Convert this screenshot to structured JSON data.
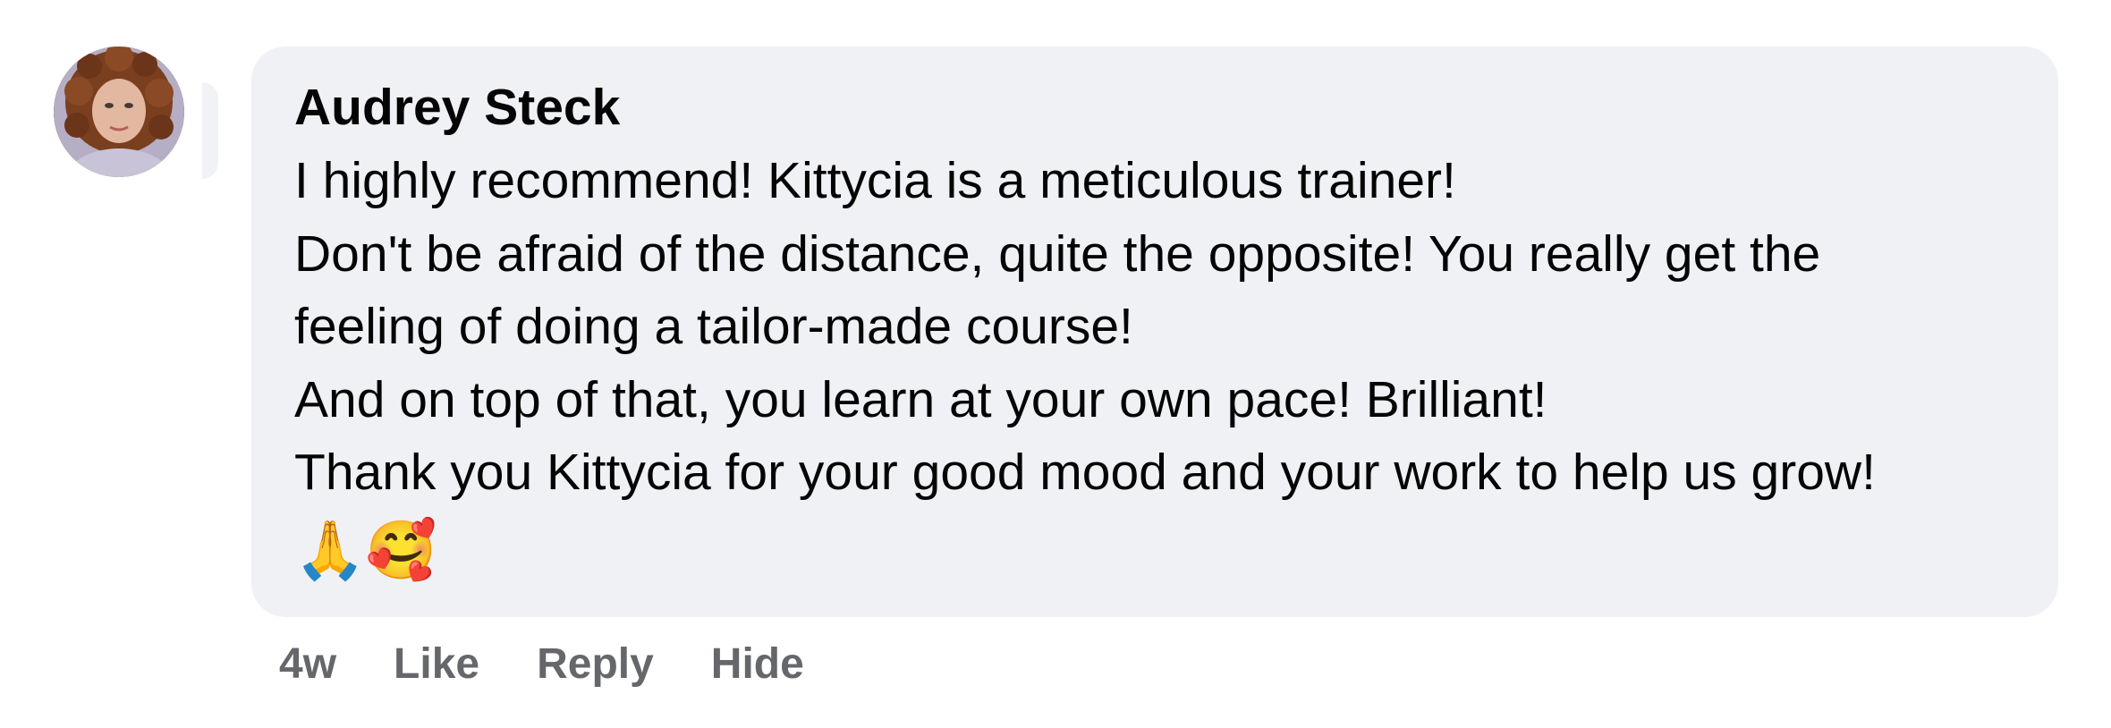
{
  "comment": {
    "author": "Audrey Steck",
    "lines": [
      "I highly recommend! Kittycia is a meticulous trainer!",
      "Don't be afraid of the distance, quite the opposite! You really get the",
      "feeling of doing a tailor-made course!",
      "And on top of that, you learn at your own pace! Brilliant!",
      "Thank you Kittycia for your good mood and your work to help us grow!"
    ],
    "emojis": "🙏🥰"
  },
  "actions": {
    "time": "4w",
    "like": "Like",
    "reply": "Reply",
    "hide": "Hide"
  },
  "colors": {
    "bubble": "#f0f1f5",
    "text": "#050505",
    "muted": "#65676b"
  },
  "icons": {
    "avatar": "profile-photo"
  }
}
